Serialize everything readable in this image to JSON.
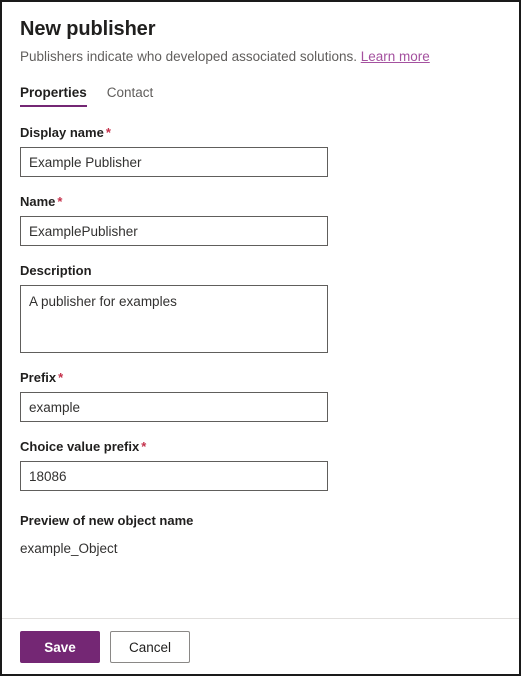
{
  "dialog": {
    "title": "New publisher",
    "subtitle_text": "Publishers indicate who developed associated solutions.",
    "learn_more_label": "Learn more"
  },
  "tabs": [
    {
      "label": "Properties",
      "active": true
    },
    {
      "label": "Contact",
      "active": false
    }
  ],
  "fields": {
    "display_name": {
      "label": "Display name",
      "required_marker": "*",
      "value": "Example Publisher",
      "placeholder": ""
    },
    "name": {
      "label": "Name",
      "required_marker": "*",
      "value": "ExamplePublisher",
      "placeholder": ""
    },
    "description": {
      "label": "Description",
      "value": "A publisher for examples",
      "placeholder": ""
    },
    "prefix": {
      "label": "Prefix",
      "required_marker": "*",
      "value": "example",
      "placeholder": ""
    },
    "choice_value_prefix": {
      "label": "Choice value prefix",
      "required_marker": "*",
      "value": "18086",
      "placeholder": ""
    }
  },
  "preview": {
    "label": "Preview of new object name",
    "value": "example_Object"
  },
  "footer": {
    "save_label": "Save",
    "cancel_label": "Cancel"
  },
  "colors": {
    "accent_purple": "#742774",
    "link_purple": "#a4519f",
    "required_red": "#c4314b",
    "text_primary": "#201f1e",
    "text_secondary": "#605e5c",
    "border_input": "#605e5c",
    "divider": "#e1dfdd"
  }
}
